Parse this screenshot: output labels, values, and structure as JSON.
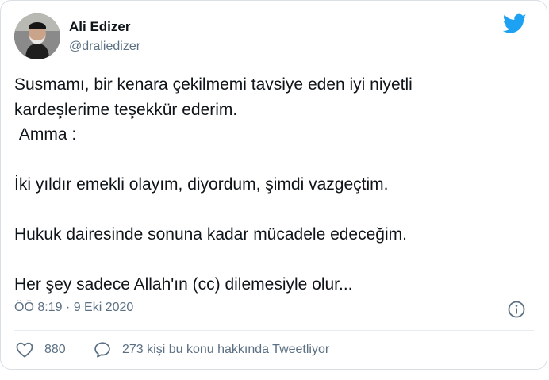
{
  "author": {
    "display_name": "Ali Edizer",
    "handle": "@draliedizer",
    "avatar_icon": "profile-photo"
  },
  "brand": {
    "icon": "twitter-bird-icon",
    "color": "#1da1f2"
  },
  "tweet": {
    "text": "Susmamı, bir kenara çekilmemi tavsiye eden iyi niyetli\nkardeşlerime teşekkür ederim.\n Amma :\n\nİki yıldır emekli olayım, diyordum, şimdi vazgeçtim.\n\nHukuk dairesinde sonuna kadar mücadele edeceğim.\n\nHer şey sadece Allah'ın (cc) dilemesiyle olur...",
    "timestamp": "ÖÖ 8:19 · 9 Eki 2020"
  },
  "actions": {
    "like_count": "880",
    "reply_label": "273 kişi bu konu hakkında Tweetliyor"
  },
  "icons": {
    "info": "info-icon",
    "like": "heart-icon",
    "reply": "speech-bubble-icon"
  },
  "colors": {
    "text_primary": "#0f1419",
    "text_secondary": "#5b7083",
    "border": "#d9dfe4"
  }
}
